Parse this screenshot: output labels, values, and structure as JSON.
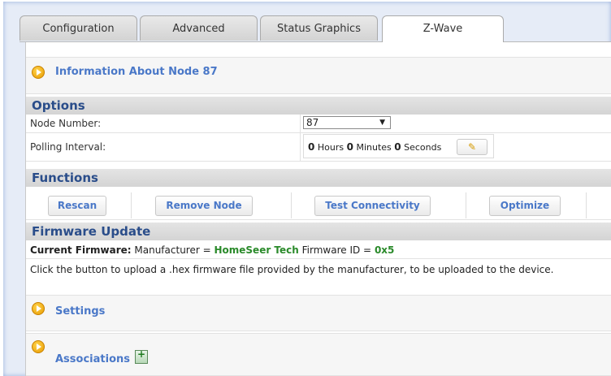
{
  "tabs": [
    "Configuration",
    "Advanced",
    "Status Graphics",
    "Z-Wave"
  ],
  "info_link": "Information About Node 87",
  "options": {
    "header": "Options",
    "node_number_label": "Node Number:",
    "node_number_value": "87",
    "polling_label": "Polling Interval:",
    "polling": {
      "hours": "0",
      "hours_unit": "Hours",
      "minutes": "0",
      "minutes_unit": "Minutes",
      "seconds": "0",
      "seconds_unit": "Seconds"
    }
  },
  "functions": {
    "header": "Functions",
    "buttons": [
      "Rescan",
      "Remove Node",
      "Test Connectivity",
      "Optimize"
    ]
  },
  "firmware": {
    "header": "Firmware Update",
    "current_label": "Current Firmware:",
    "manufacturer_prefix": "Manufacturer =",
    "manufacturer": "HomeSeer Tech",
    "fw_id_prefix": "Firmware ID =",
    "fw_id": "0x5",
    "description": "Click the button to upload a .hex firmware file provided by the manufacturer, to be uploaded to the device."
  },
  "settings_link": "Settings",
  "associations_link": "Associations",
  "icons": {
    "expand": "expand-arrow-icon",
    "edit": "pencil-icon",
    "associations": "add-association-icon"
  },
  "colors": {
    "link": "#4a78c8",
    "section": "#2a4d8a",
    "firmware_value": "#2a8a2a"
  }
}
